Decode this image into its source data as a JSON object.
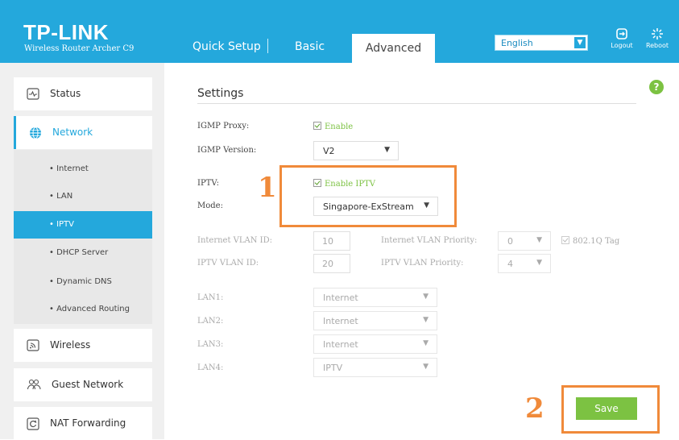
{
  "header": {
    "brand": "TP-LINK",
    "model": "Wireless Router Archer C9",
    "tabs": [
      "Quick Setup",
      "Basic",
      "Advanced"
    ],
    "language": "English",
    "logout": "Logout",
    "reboot": "Reboot"
  },
  "sidebar": {
    "items": [
      {
        "label": "Status",
        "icon": "status-icon"
      },
      {
        "label": "Network",
        "icon": "globe-icon"
      },
      {
        "label": "Wireless",
        "icon": "wireless-icon"
      },
      {
        "label": "Guest Network",
        "icon": "guest-icon"
      },
      {
        "label": "NAT Forwarding",
        "icon": "nat-icon"
      }
    ],
    "subitems": [
      "Internet",
      "LAN",
      "IPTV",
      "DHCP Server",
      "Dynamic DNS",
      "Advanced Routing"
    ]
  },
  "main": {
    "help": "?",
    "title": "Settings",
    "igmp_proxy_label": "IGMP Proxy:",
    "igmp_proxy_value": "Enable",
    "igmp_version_label": "IGMP Version:",
    "igmp_version_value": "V2",
    "iptv_label": "IPTV:",
    "iptv_value": "Enable IPTV",
    "mode_label": "Mode:",
    "mode_value": "Singapore-ExStream",
    "internet_vlan_id_label": "Internet VLAN ID:",
    "internet_vlan_id_value": "10",
    "internet_vlan_priority_label": "Internet VLAN Priority:",
    "internet_vlan_priority_value": "0",
    "tag_label": "802.1Q Tag",
    "iptv_vlan_id_label": "IPTV VLAN ID:",
    "iptv_vlan_id_value": "20",
    "iptv_vlan_priority_label": "IPTV VLAN Priority:",
    "iptv_vlan_priority_value": "4",
    "lan": [
      {
        "label": "LAN1:",
        "value": "Internet"
      },
      {
        "label": "LAN2:",
        "value": "Internet"
      },
      {
        "label": "LAN3:",
        "value": "Internet"
      },
      {
        "label": "LAN4:",
        "value": "IPTV"
      }
    ],
    "save": "Save"
  },
  "annotations": {
    "step1": "1",
    "step2": "2"
  },
  "colors": {
    "brand": "#24a8dc",
    "accent_green": "#7cc242",
    "highlight_orange": "#f08a3a"
  }
}
